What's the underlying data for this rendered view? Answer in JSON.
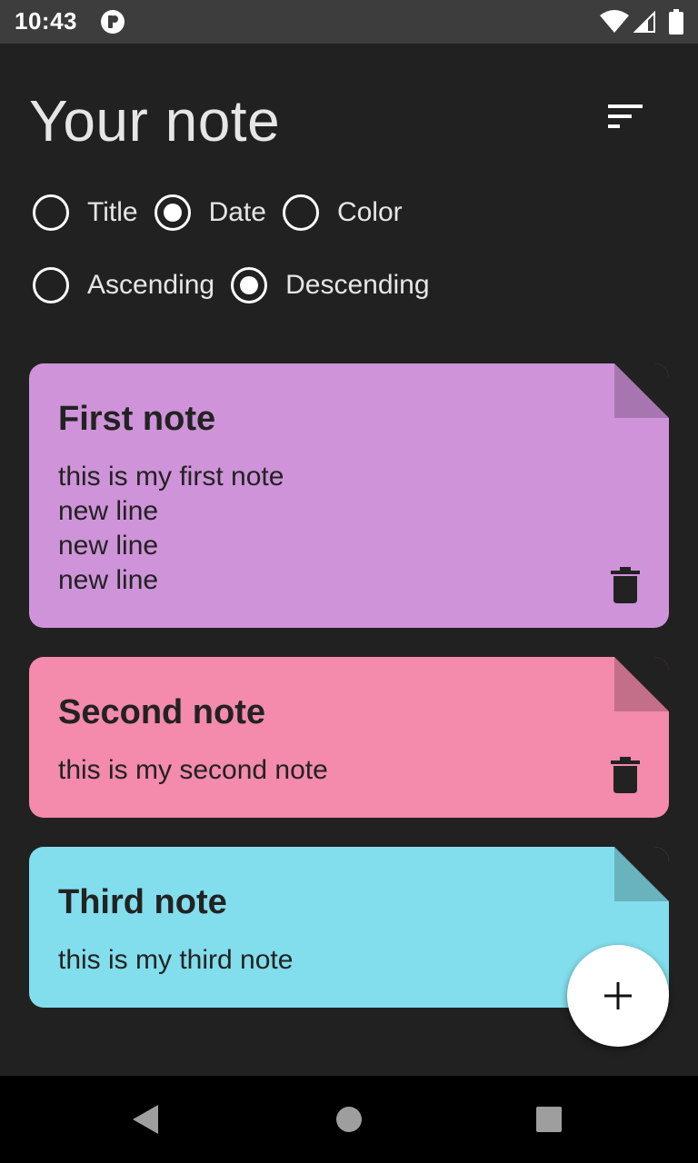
{
  "status_bar": {
    "time": "10:43"
  },
  "header": {
    "title": "Your note",
    "sort_icon": "sort-icon"
  },
  "sort_options": {
    "order_by": [
      {
        "label": "Title",
        "checked": false
      },
      {
        "label": "Date",
        "checked": true
      },
      {
        "label": "Color",
        "checked": false
      }
    ],
    "direction": [
      {
        "label": "Ascending",
        "checked": false
      },
      {
        "label": "Descending",
        "checked": true
      }
    ]
  },
  "notes": [
    {
      "title": "First note",
      "body": "this is my first note\nnew line\nnew line\nnew line",
      "color": "#ce93d8",
      "fold_color": "#a776b0"
    },
    {
      "title": "Second note",
      "body": "this is my second note",
      "color": "#f48aac",
      "fold_color": "#c46f8a"
    },
    {
      "title": "Third note",
      "body": "this is my third note",
      "color": "#82deec",
      "fold_color": "#69b3be"
    }
  ],
  "fab": {
    "icon": "plus-icon"
  },
  "nav": {
    "back_icon": "back-icon",
    "home_icon": "home-icon",
    "recents_icon": "recents-icon"
  }
}
